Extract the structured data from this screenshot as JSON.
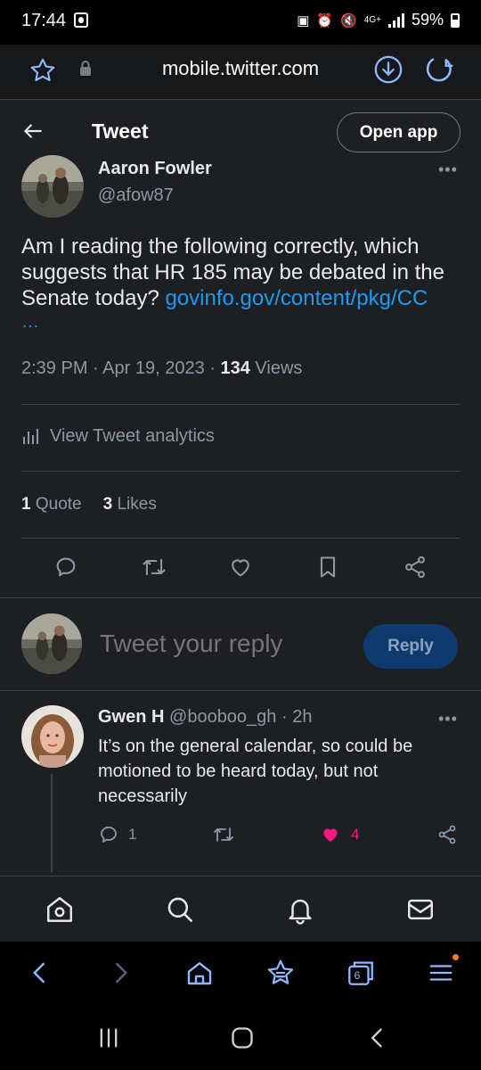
{
  "status_bar": {
    "time": "17:44",
    "battery": "59%",
    "network": "4G+"
  },
  "browser": {
    "url": "mobile.twitter.com",
    "tab_count": "6"
  },
  "header": {
    "title": "Tweet",
    "open_app_label": "Open app"
  },
  "tweet": {
    "author_name": "Aaron Fowler",
    "author_handle": "@afow87",
    "text": "Am I reading the following correctly, which suggests that HR 185 may be debated in the Senate today? ",
    "link": "govinfo.gov/content/pkg/CC",
    "link_ellipsis": "…",
    "time": "2:39 PM",
    "date": "Apr 19, 2023",
    "views_count": "134",
    "views_label": "Views",
    "analytics_label": "View Tweet analytics",
    "quotes_count": "1",
    "quotes_label": "Quote",
    "likes_count": "3",
    "likes_label": "Likes"
  },
  "compose": {
    "placeholder": "Tweet your reply",
    "reply_label": "Reply"
  },
  "reply": {
    "author_name": "Gwen H",
    "author_handle": "@booboo_gh",
    "time": "2h",
    "text": "It’s on the general calendar, so could be motioned to be heard today, but not necessarily",
    "reply_count": "1",
    "like_count": "4"
  },
  "colors": {
    "accent": "#1d9bf0",
    "like_pink": "#f91880",
    "background": "#1e1f22"
  },
  "icons": {
    "browser": [
      "star-icon",
      "lock-icon",
      "download-icon",
      "reload-icon"
    ],
    "actions": [
      "reply-icon",
      "retweet-icon",
      "like-icon",
      "bookmark-icon",
      "share-icon"
    ],
    "nav": [
      "home-icon",
      "search-icon",
      "notifications-icon",
      "messages-icon"
    ]
  }
}
